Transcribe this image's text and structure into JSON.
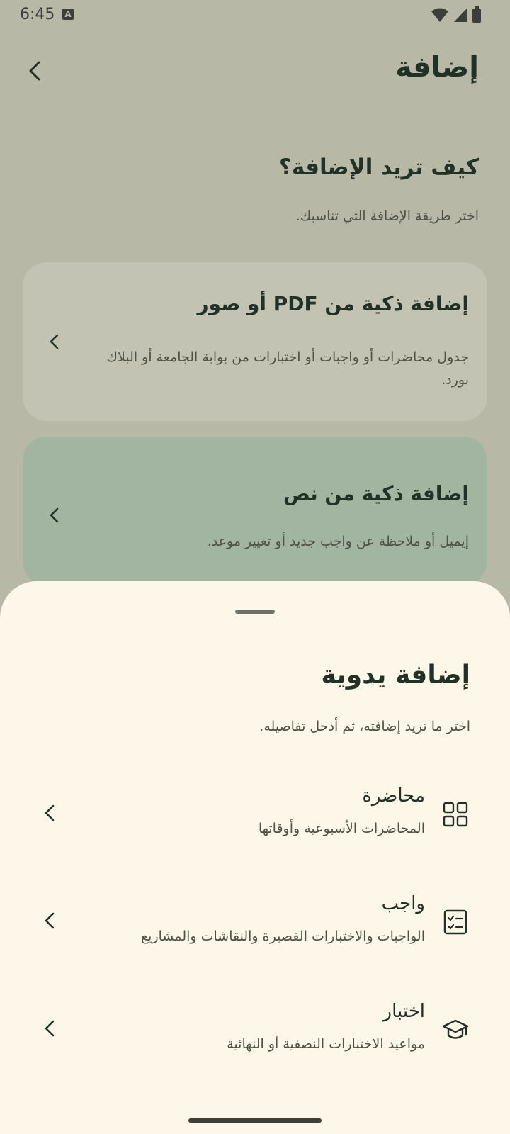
{
  "status_bar": {
    "time": "6:45",
    "a_badge": "A"
  },
  "header": {
    "title": "إضافة",
    "back_icon": "chevron-left-icon"
  },
  "intro": {
    "title": "كيف تريد الإضافة؟",
    "subtitle": "اختر طريقة الإضافة التي تناسبك."
  },
  "cards": [
    {
      "title": "إضافة ذكية من PDF أو صور",
      "description": "جدول محاضرات أو واجبات أو اختبارات من بوابة الجامعة أو البلاك بورد."
    },
    {
      "title": "إضافة ذكية من نص",
      "description": "إيميل أو ملاحظة عن واجب جديد أو تغيير موعد."
    }
  ],
  "sheet": {
    "title": "إضافة يدوية",
    "subtitle": "اختر ما تريد إضافته، ثم أدخل تفاصيله.",
    "options": [
      {
        "title": "محاضرة",
        "description": "المحاضرات الأسبوعية وأوقاتها",
        "icon": "grid-icon"
      },
      {
        "title": "واجب",
        "description": "الواجبات والاختبارات القصيرة والنقاشات والمشاريع",
        "icon": "checklist-icon"
      },
      {
        "title": "اختبار",
        "description": "مواعيد الاختبارات النصفية أو النهائية",
        "icon": "graduation-cap-icon"
      }
    ]
  },
  "colors": {
    "scrim_background": "#b8b8a6",
    "sheet_background": "#fdf7e9",
    "text_primary": "#223126",
    "text_secondary": "#4d5347",
    "card_neutral": "#c2c3b2",
    "card_green": "#a2b5a0"
  }
}
